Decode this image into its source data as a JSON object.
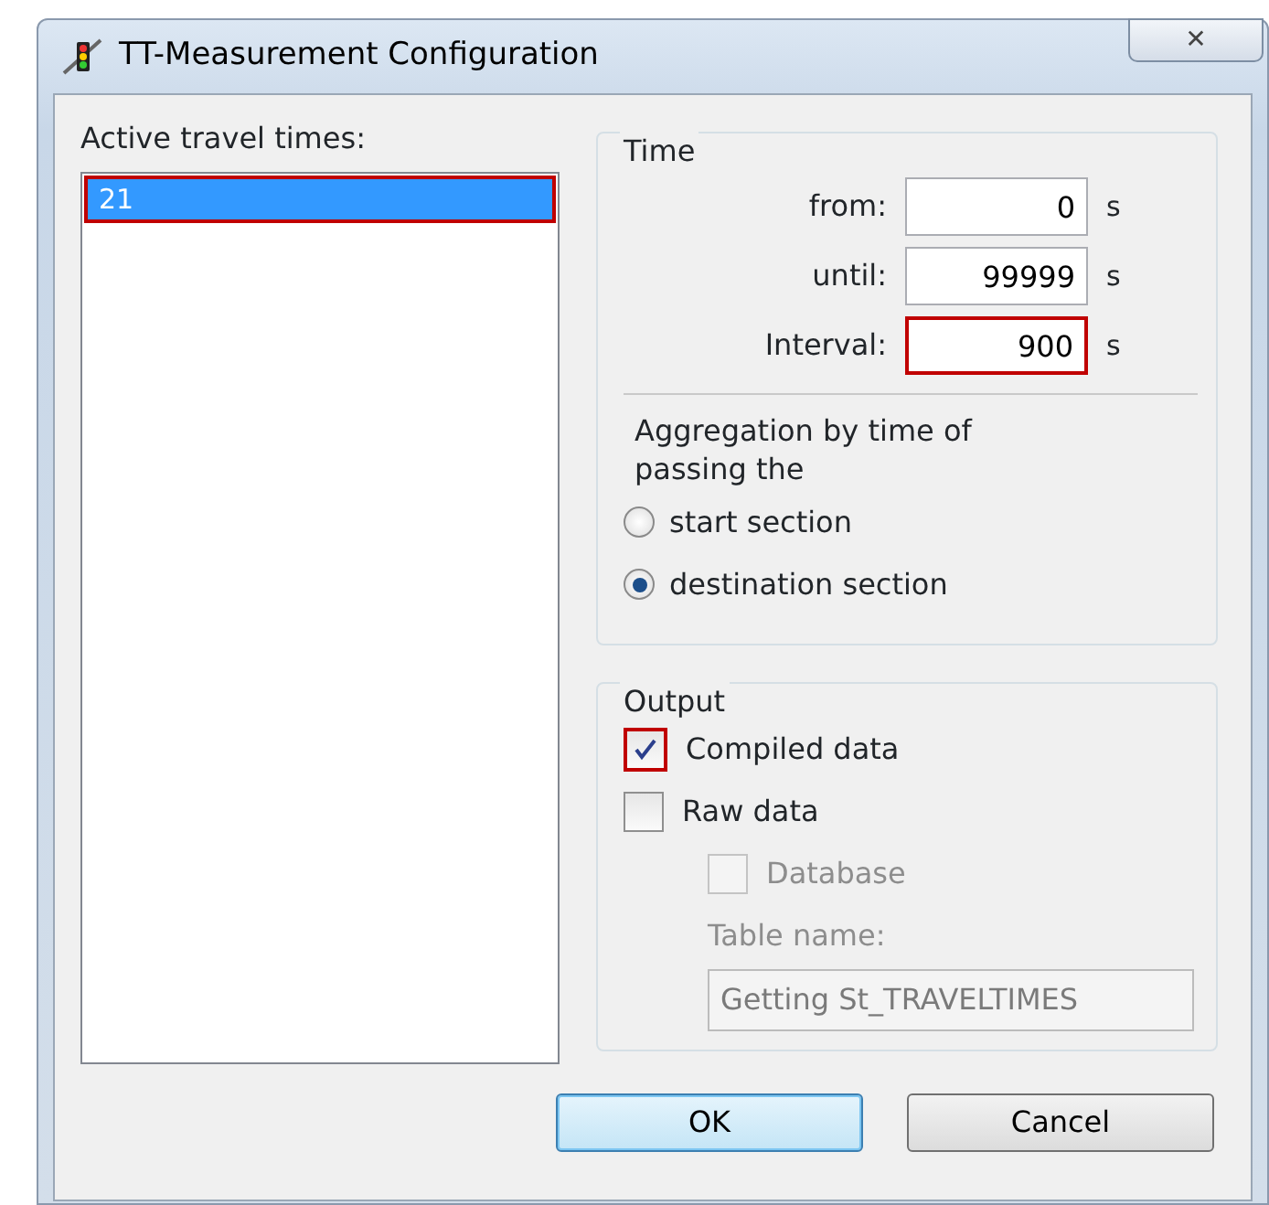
{
  "window": {
    "title": "TT-Measurement Configuration",
    "close": "✕"
  },
  "travel_times": {
    "label": "Active travel times:",
    "items": [
      {
        "text": "21",
        "selected": true,
        "highlighted": true
      }
    ]
  },
  "time": {
    "title": "Time",
    "fields": [
      {
        "label": "from:",
        "value": "0",
        "unit": "s",
        "highlighted": false
      },
      {
        "label": "until:",
        "value": "99999",
        "unit": "s",
        "highlighted": false
      },
      {
        "label": "Interval:",
        "value": "900",
        "unit": "s",
        "highlighted": true
      }
    ],
    "aggregation_label": "Aggregation by time of passing the",
    "options": [
      {
        "label": "start section",
        "selected": false
      },
      {
        "label": "destination section",
        "selected": true
      }
    ]
  },
  "output": {
    "title": "Output",
    "checks": [
      {
        "label": "Compiled data",
        "checked": true,
        "disabled": false,
        "highlighted": true
      },
      {
        "label": "Raw data",
        "checked": false,
        "disabled": false,
        "highlighted": false,
        "children": [
          {
            "label": "Database",
            "checked": false,
            "disabled": true,
            "highlighted": false
          }
        ]
      }
    ],
    "table_label": "Table name:",
    "table_value": "Getting St_TRAVELTIMES",
    "table_disabled": true
  },
  "buttons": [
    {
      "label": "OK",
      "default": true
    },
    {
      "label": "Cancel",
      "default": false
    }
  ]
}
